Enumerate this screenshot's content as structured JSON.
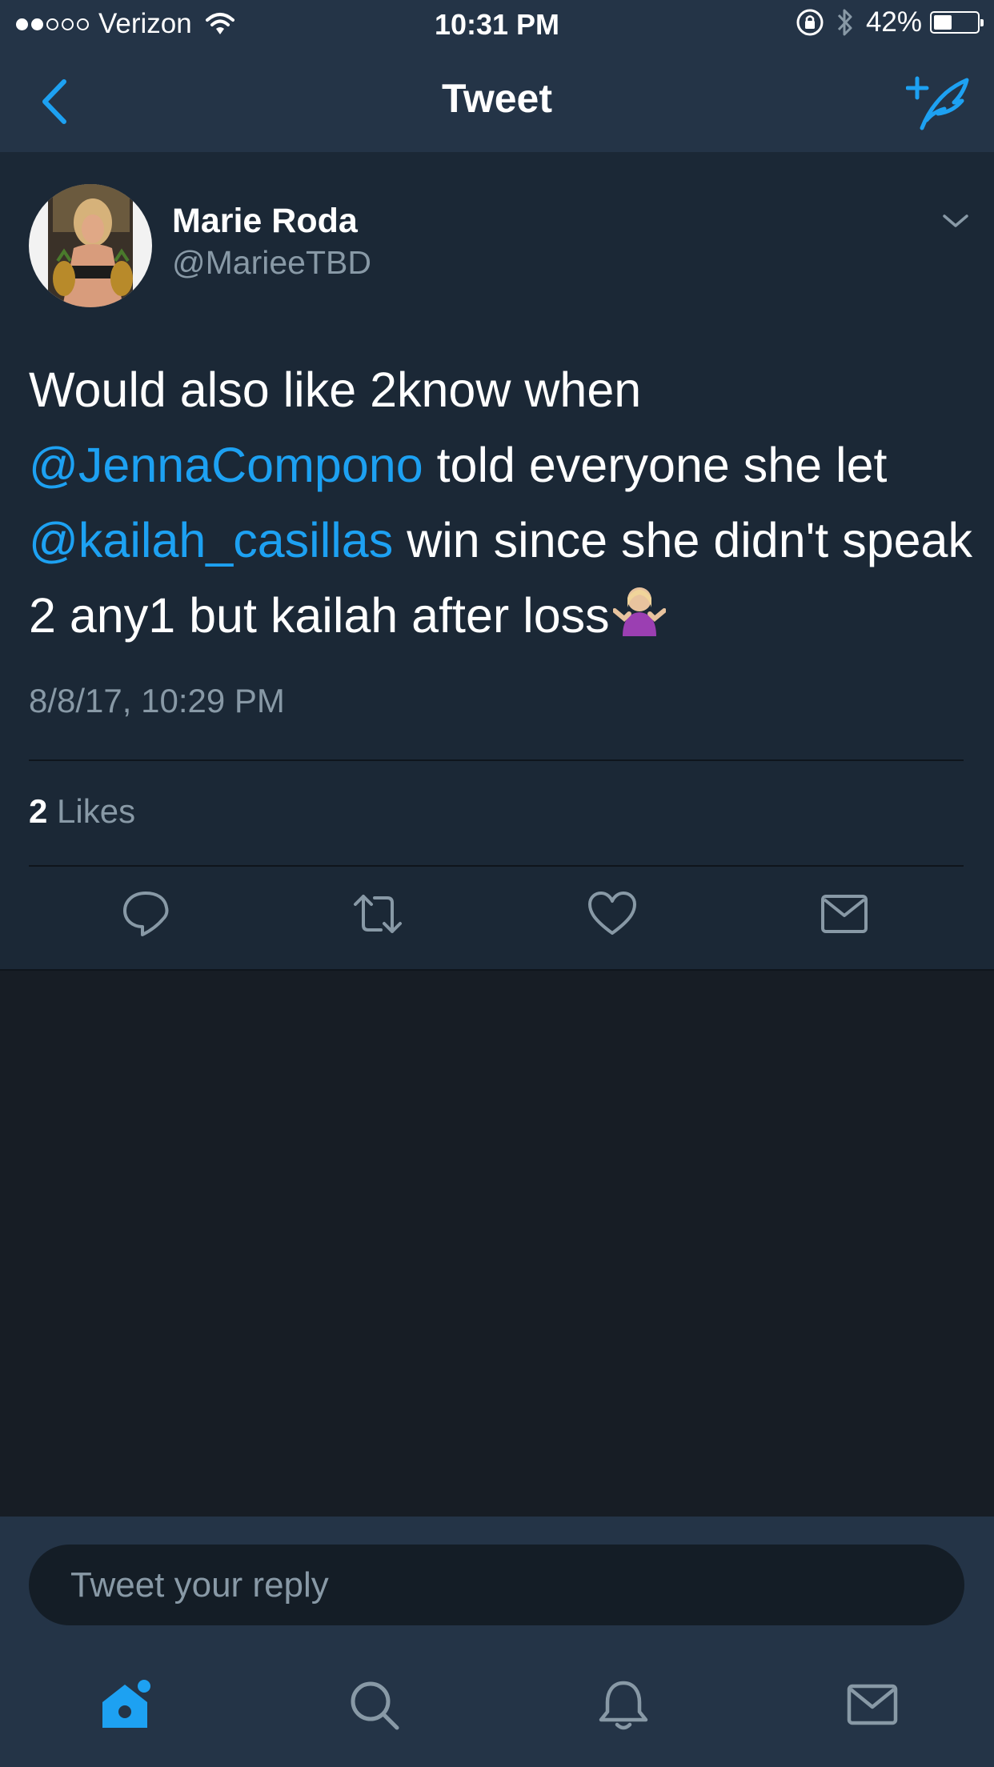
{
  "status_bar": {
    "carrier": "Verizon",
    "time": "10:31 PM",
    "battery": "42%",
    "battery_level": 0.42
  },
  "nav": {
    "title": "Tweet",
    "back_icon": "chevron-left-icon",
    "compose_icon": "compose-tweet-icon"
  },
  "tweet": {
    "author_name": "Marie Roda",
    "author_handle": "@MarieeTBD",
    "text_1": "Would also like 2know when",
    "mention_1": "@JennaCompono",
    "text_2": " told everyone she let",
    "mention_2": "@kailah_casillas",
    "text_3": " win since she didn't speak 2 any1 but kailah after loss",
    "emoji": "🤷🏼‍♀️",
    "date": "8/8/17, 10:29 PM",
    "likes_count": "2",
    "likes_label": " Likes"
  },
  "reply": {
    "placeholder": "Tweet your reply"
  },
  "tabs": [
    "home-icon",
    "search-icon",
    "notifications-icon",
    "messages-icon"
  ],
  "colors": {
    "accent": "#1da1f2",
    "header_bg": "#243447",
    "tweet_bg": "#1b2836",
    "page_bg": "#171d25",
    "muted_text": "#8899a6"
  }
}
